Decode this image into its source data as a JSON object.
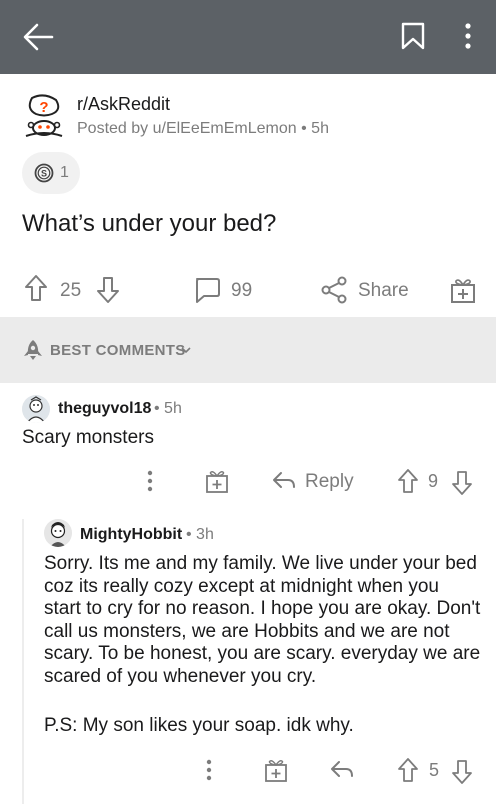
{
  "post": {
    "subreddit": "r/AskReddit",
    "posted_by": "Posted by u/ElEeEmEmLemon",
    "age": "5h",
    "award_count": "1",
    "title": "What’s under your bed?",
    "upvotes": "25",
    "comments": "99",
    "share_label": "Share"
  },
  "sort": {
    "label": "BEST COMMENTS"
  },
  "comments": [
    {
      "user": "theguyvol18",
      "age": "5h",
      "body": "Scary monsters",
      "reply_label": "Reply",
      "votes": "9"
    },
    {
      "user": "MightyHobbit",
      "age": "3h",
      "body_lines": [
        "Sorry. Its me and my family. We live under your bed",
        "coz its really cozy except at midnight when you",
        "start to cry for no reason. I hope you are okay. Don't",
        "call us monsters, we are Hobbits and we are not",
        "scary. To be honest, you are scary. everyday we are",
        "scared of you whenever you cry."
      ],
      "ps": "P.S: My son likes your soap. idk why.",
      "votes": "5"
    }
  ],
  "colors": {
    "topbar": "#5c6166",
    "text": "#1a1a1b",
    "meta": "#7c7c7c",
    "divider": "#ebebeb"
  }
}
